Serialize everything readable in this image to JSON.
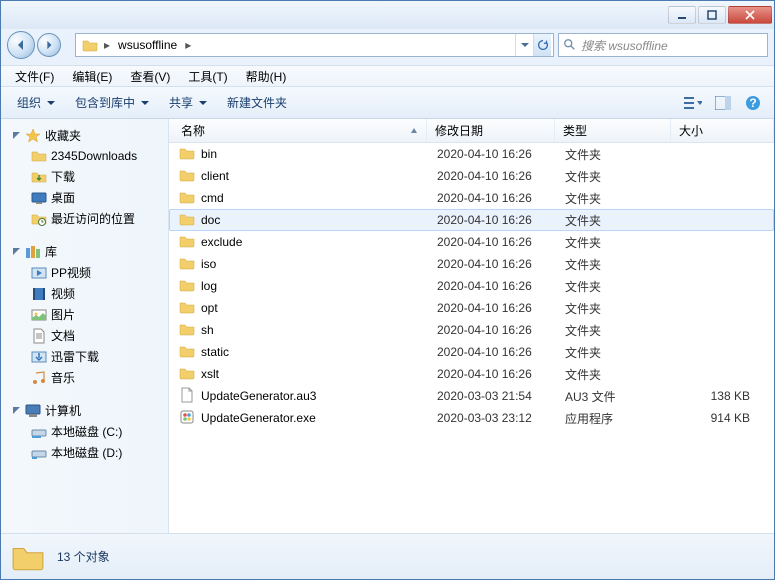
{
  "navigation": {
    "breadcrumb": "wsusoffline",
    "breadcrumb_sep": "▸",
    "search_placeholder": "搜索 wsusoffline"
  },
  "menubar": {
    "file": "文件(F)",
    "edit": "编辑(E)",
    "view": "查看(V)",
    "tools": "工具(T)",
    "help": "帮助(H)"
  },
  "toolbar": {
    "organize": "组织",
    "include": "包含到库中",
    "share": "共享",
    "newfolder": "新建文件夹"
  },
  "sidebar": {
    "favorites": {
      "label": "收藏夹",
      "items": [
        "2345Downloads",
        "下载",
        "桌面",
        "最近访问的位置"
      ]
    },
    "libraries": {
      "label": "库",
      "items": [
        "PP视频",
        "视频",
        "图片",
        "文档",
        "迅雷下载",
        "音乐"
      ]
    },
    "computer": {
      "label": "计算机",
      "items": [
        "本地磁盘 (C:)",
        "本地磁盘 (D:)"
      ]
    }
  },
  "columns": {
    "name": "名称",
    "date": "修改日期",
    "type": "类型",
    "size": "大小"
  },
  "files": [
    {
      "name": "bin",
      "date": "2020-04-10 16:26",
      "type": "文件夹",
      "size": "",
      "kind": "folder"
    },
    {
      "name": "client",
      "date": "2020-04-10 16:26",
      "type": "文件夹",
      "size": "",
      "kind": "folder"
    },
    {
      "name": "cmd",
      "date": "2020-04-10 16:26",
      "type": "文件夹",
      "size": "",
      "kind": "folder"
    },
    {
      "name": "doc",
      "date": "2020-04-10 16:26",
      "type": "文件夹",
      "size": "",
      "kind": "folder",
      "hover": true
    },
    {
      "name": "exclude",
      "date": "2020-04-10 16:26",
      "type": "文件夹",
      "size": "",
      "kind": "folder"
    },
    {
      "name": "iso",
      "date": "2020-04-10 16:26",
      "type": "文件夹",
      "size": "",
      "kind": "folder"
    },
    {
      "name": "log",
      "date": "2020-04-10 16:26",
      "type": "文件夹",
      "size": "",
      "kind": "folder"
    },
    {
      "name": "opt",
      "date": "2020-04-10 16:26",
      "type": "文件夹",
      "size": "",
      "kind": "folder"
    },
    {
      "name": "sh",
      "date": "2020-04-10 16:26",
      "type": "文件夹",
      "size": "",
      "kind": "folder"
    },
    {
      "name": "static",
      "date": "2020-04-10 16:26",
      "type": "文件夹",
      "size": "",
      "kind": "folder"
    },
    {
      "name": "xslt",
      "date": "2020-04-10 16:26",
      "type": "文件夹",
      "size": "",
      "kind": "folder"
    },
    {
      "name": "UpdateGenerator.au3",
      "date": "2020-03-03 21:54",
      "type": "AU3 文件",
      "size": "138 KB",
      "kind": "file"
    },
    {
      "name": "UpdateGenerator.exe",
      "date": "2020-03-03 23:12",
      "type": "应用程序",
      "size": "914 KB",
      "kind": "exe"
    }
  ],
  "status": {
    "count_text": "13 个对象"
  }
}
